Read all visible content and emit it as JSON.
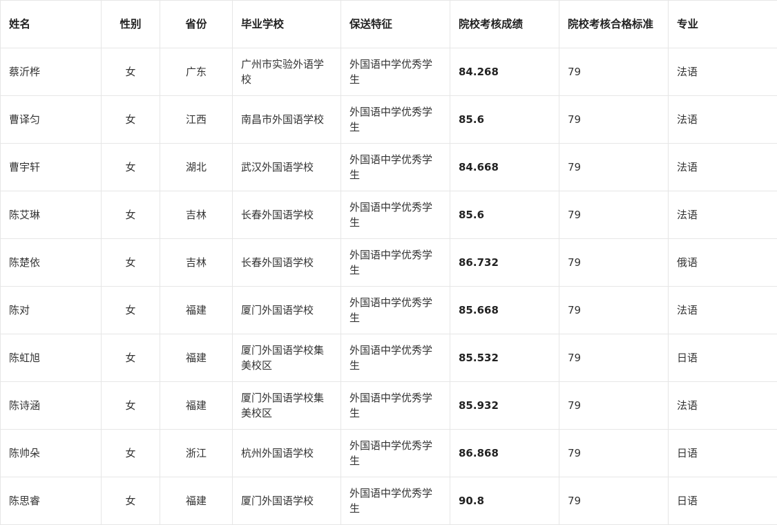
{
  "table": {
    "headers": [
      "姓名",
      "性别",
      "省份",
      "毕业学校",
      "保送特征",
      "院校考核成绩",
      "院校考核合格标准",
      "专业"
    ],
    "rows": [
      [
        "蔡沂桦",
        "女",
        "广东",
        "广州市实验外语学校",
        "外国语中学优秀学生",
        "84.268",
        "79",
        "法语"
      ],
      [
        "曹译匀",
        "女",
        "江西",
        "南昌市外国语学校",
        "外国语中学优秀学生",
        "85.6",
        "79",
        "法语"
      ],
      [
        "曹宇轩",
        "女",
        "湖北",
        "武汉外国语学校",
        "外国语中学优秀学生",
        "84.668",
        "79",
        "法语"
      ],
      [
        "陈艾琳",
        "女",
        "吉林",
        "长春外国语学校",
        "外国语中学优秀学生",
        "85.6",
        "79",
        "法语"
      ],
      [
        "陈楚依",
        "女",
        "吉林",
        "长春外国语学校",
        "外国语中学优秀学生",
        "86.732",
        "79",
        "俄语"
      ],
      [
        "陈对",
        "女",
        "福建",
        "厦门外国语学校",
        "外国语中学优秀学生",
        "85.668",
        "79",
        "法语"
      ],
      [
        "陈虹旭",
        "女",
        "福建",
        "厦门外国语学校集美校区",
        "外国语中学优秀学生",
        "85.532",
        "79",
        "日语"
      ],
      [
        "陈诗涵",
        "女",
        "福建",
        "厦门外国语学校集美校区",
        "外国语中学优秀学生",
        "85.932",
        "79",
        "法语"
      ],
      [
        "陈帅朵",
        "女",
        "浙江",
        "杭州外国语学校",
        "外国语中学优秀学生",
        "86.868",
        "79",
        "日语"
      ],
      [
        "陈思睿",
        "女",
        "福建",
        "厦门外国语学校",
        "外国语中学优秀学生",
        "90.8",
        "79",
        "日语"
      ]
    ]
  }
}
